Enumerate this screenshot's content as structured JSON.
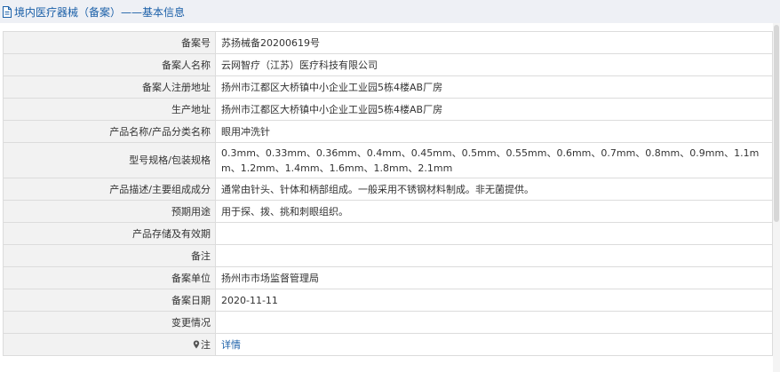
{
  "header": {
    "title": "境内医疗器械（备案）——基本信息"
  },
  "rows": [
    {
      "label": "备案号",
      "value": "苏扬械备20200619号"
    },
    {
      "label": "备案人名称",
      "value": "云网智疗（江苏）医疗科技有限公司"
    },
    {
      "label": "备案人注册地址",
      "value": "扬州市江都区大桥镇中小企业工业园5栋4楼AB厂房"
    },
    {
      "label": "生产地址",
      "value": "扬州市江都区大桥镇中小企业工业园5栋4楼AB厂房"
    },
    {
      "label": "产品名称/产品分类名称",
      "value": "眼用冲洗针"
    },
    {
      "label": "型号规格/包装规格",
      "value": "0.3mm、0.33mm、0.36mm、0.4mm、0.45mm、0.5mm、0.55mm、0.6mm、0.7mm、0.8mm、0.9mm、1.1mm、1.2mm、1.4mm、1.6mm、1.8mm、2.1mm"
    },
    {
      "label": "产品描述/主要组成成分",
      "value": "通常由针头、针体和柄部组成。一般采用不锈钢材料制成。非无菌提供。"
    },
    {
      "label": "预期用途",
      "value": "用于探、拨、挑和刺眼组织。"
    },
    {
      "label": "产品存储及有效期",
      "value": ""
    },
    {
      "label": "备注",
      "value": ""
    },
    {
      "label": "备案单位",
      "value": "扬州市市场监督管理局"
    },
    {
      "label": "备案日期",
      "value": "2020-11-11"
    },
    {
      "label": "变更情况",
      "value": ""
    }
  ],
  "note": {
    "label": "注",
    "link": "详情",
    "icon": "pin-icon"
  },
  "colors": {
    "accent": "#1a5fa8",
    "label_bg": "#f2f2f2",
    "border": "#dcdcdc",
    "title_bg": "#eef0f5"
  }
}
